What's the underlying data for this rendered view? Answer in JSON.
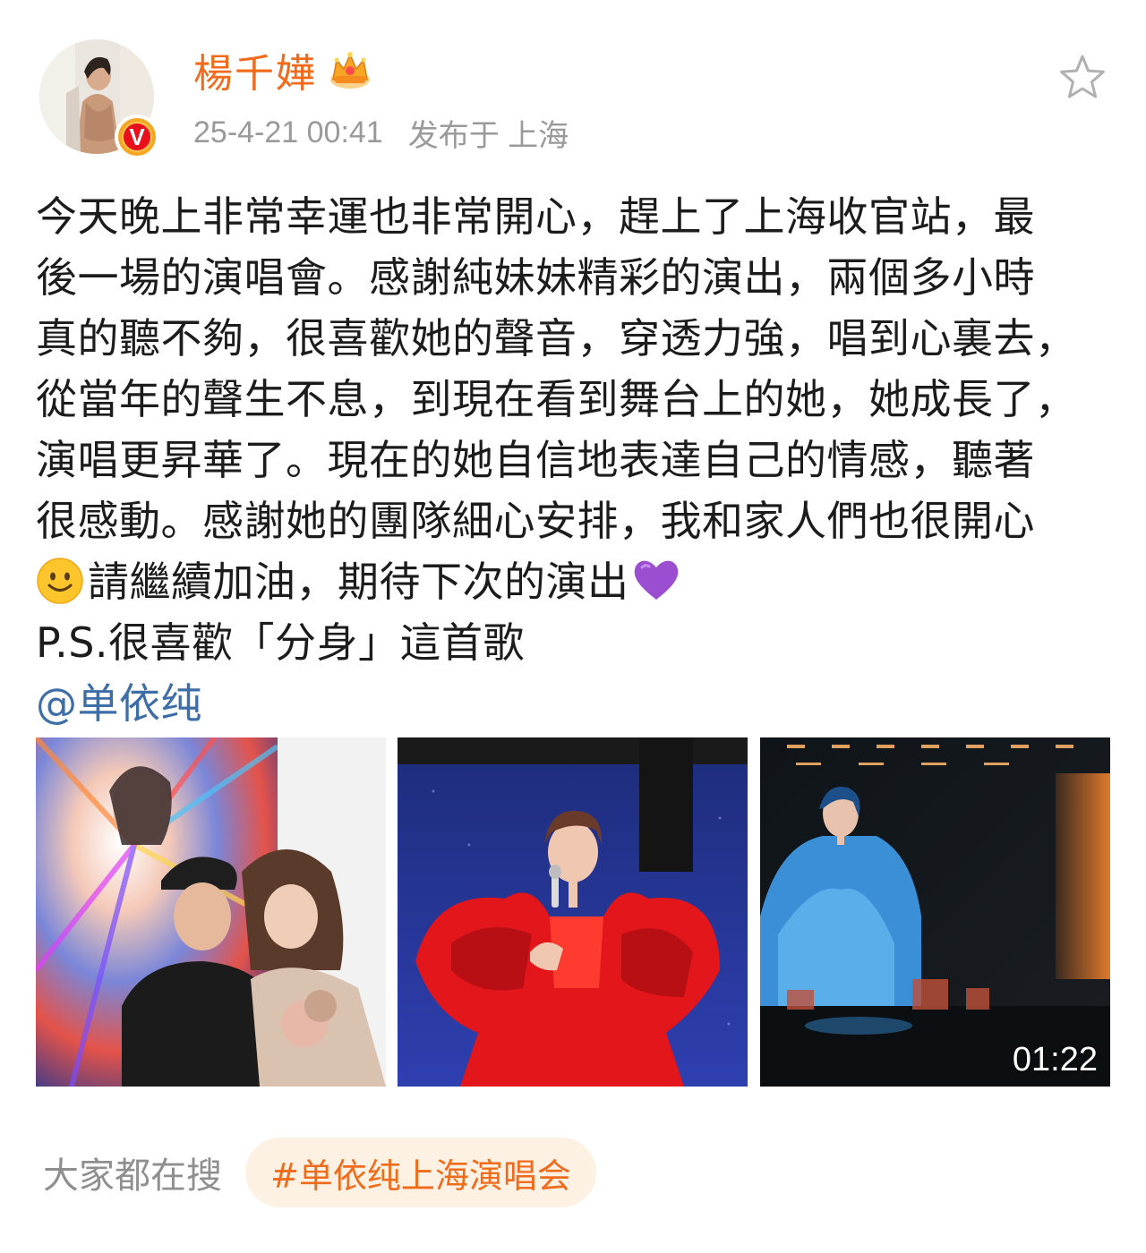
{
  "post": {
    "author": {
      "name": "楊千嬅",
      "avatar_icon": "avatar-photo",
      "verified_badge_letter": "V",
      "badge_icon": "crown-icon"
    },
    "timestamp": "25-4-21 00:41",
    "location": "发布于 上海",
    "favorite_icon": "star-outline-icon",
    "body_lines": [
      "今天晚上非常幸運也非常開心，趕上了上海收官站，最",
      "後一場的演唱會。感謝純妹妹精彩的演出，兩個多小時",
      "真的聽不夠，很喜歡她的聲音，穿透力強，唱到心裏去，",
      "從當年的聲生不息，到現在看到舞台上的她，她成長了，",
      "演唱更昇華了。現在的她自信地表達自己的情感，聽著",
      "很感動。感謝她的團隊細心安排，我和家人們也很開心"
    ],
    "line7_text": "請繼續加油，期待下次的演出",
    "ps_line": "P.S.很喜歡「分身」這首歌",
    "mention": "@单依纯",
    "media": [
      {
        "type": "photo",
        "icon": "photo-selfie"
      },
      {
        "type": "photo",
        "icon": "photo-red-dress-singer"
      },
      {
        "type": "video",
        "icon": "video-blue-stage",
        "duration": "01:22"
      }
    ]
  },
  "footer": {
    "search_label": "大家都在搜",
    "hashtag": "#单依纯上海演唱会"
  },
  "colors": {
    "username": "#f26b1d",
    "meta": "#9a9a9a",
    "body_text": "#1c1c1c",
    "mention": "#3e6ea7",
    "hashtag": "#ef6c1c",
    "hashtag_bg": "#fdf1e4"
  }
}
